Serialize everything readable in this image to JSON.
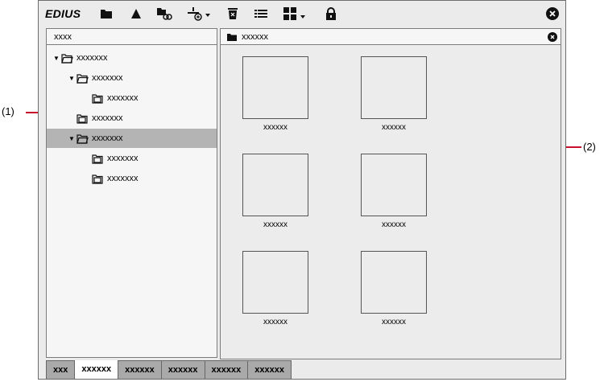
{
  "app": {
    "name": "EDIUS"
  },
  "tree": {
    "header": "xxxx",
    "items": [
      {
        "label": "xxxxxxx",
        "level": 0,
        "expanded": true,
        "selected": false
      },
      {
        "label": "xxxxxxx",
        "level": 1,
        "expanded": true,
        "selected": false
      },
      {
        "label": "xxxxxxx",
        "level": 2,
        "expanded": false,
        "selected": false
      },
      {
        "label": "xxxxxxx",
        "level": 1,
        "expanded": false,
        "selected": false
      },
      {
        "label": "xxxxxxx",
        "level": 1,
        "expanded": true,
        "selected": true
      },
      {
        "label": "xxxxxxx",
        "level": 2,
        "expanded": false,
        "selected": false
      },
      {
        "label": "xxxxxxx",
        "level": 2,
        "expanded": false,
        "selected": false
      }
    ]
  },
  "content": {
    "header": "xxxxxx",
    "thumbnails": [
      "xxxxxx",
      "xxxxxx",
      "xxxxxx",
      "xxxxxx",
      "xxxxxx",
      "xxxxxx"
    ]
  },
  "tabs": [
    {
      "label": "xxx",
      "active": false
    },
    {
      "label": "xxxxxx",
      "active": true
    },
    {
      "label": "xxxxxx",
      "active": false
    },
    {
      "label": "xxxxxx",
      "active": false
    },
    {
      "label": "xxxxxx",
      "active": false
    },
    {
      "label": "xxxxxx",
      "active": false
    }
  ],
  "callouts": {
    "left": "(1)",
    "right": "(2)"
  },
  "colors": {
    "selected_row": "#b4b4b4",
    "callout_line": "#c8102e",
    "tab_inactive": "#a9a9a9"
  }
}
